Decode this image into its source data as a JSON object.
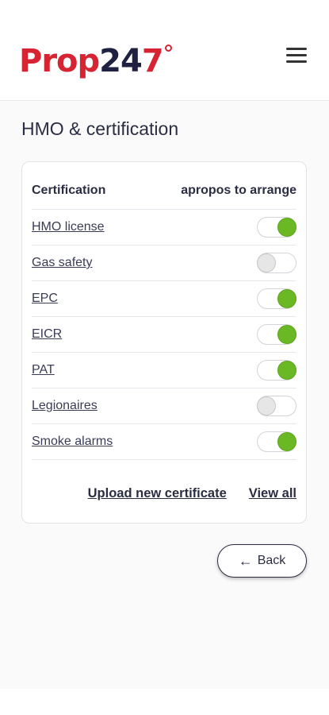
{
  "brand": {
    "prop": "Prop",
    "num": "24",
    "seven": "7",
    "accent": "#d62433",
    "dark": "#1f2140"
  },
  "page": {
    "title": "HMO & certification"
  },
  "card": {
    "col_left": "Certification",
    "col_right": "apropos to arrange",
    "rows": [
      {
        "label": "HMO license",
        "enabled": true
      },
      {
        "label": "Gas safety",
        "enabled": false
      },
      {
        "label": "EPC",
        "enabled": true
      },
      {
        "label": "EICR",
        "enabled": true
      },
      {
        "label": "PAT",
        "enabled": true
      },
      {
        "label": "Legionaires",
        "enabled": false
      },
      {
        "label": "Smoke alarms",
        "enabled": true
      }
    ],
    "upload_label": "Upload new certificate",
    "view_all_label": "View all"
  },
  "back": {
    "arrow": "←",
    "label": "Back"
  },
  "colors": {
    "toggle_on": "#6ab823",
    "toggle_off": "#e6e6e6"
  },
  "icons": {
    "menu": "hamburger-menu-icon",
    "back": "arrow-left-icon"
  }
}
